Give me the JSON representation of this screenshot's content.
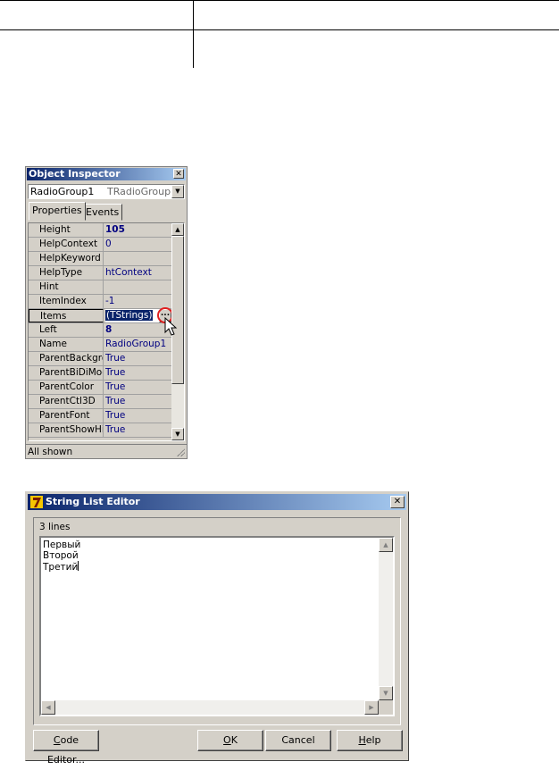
{
  "object_inspector": {
    "title": "Object Inspector",
    "component_name": "RadioGroup1",
    "component_type": "TRadioGroup",
    "tabs": [
      {
        "label": "Properties",
        "active": true
      },
      {
        "label": "Events",
        "active": false
      }
    ],
    "properties": [
      {
        "name": "Height",
        "value": "105",
        "bold": true
      },
      {
        "name": "HelpContext",
        "value": "0"
      },
      {
        "name": "HelpKeyword",
        "value": ""
      },
      {
        "name": "HelpType",
        "value": "htContext"
      },
      {
        "name": "Hint",
        "value": ""
      },
      {
        "name": "ItemIndex",
        "value": "-1"
      },
      {
        "name": "Items",
        "value": "(TStrings)",
        "selected": true
      },
      {
        "name": "Left",
        "value": "8",
        "bold": true
      },
      {
        "name": "Name",
        "value": "RadioGroup1"
      },
      {
        "name": "ParentBackgro",
        "value": "True"
      },
      {
        "name": "ParentBiDiMod",
        "value": "True"
      },
      {
        "name": "ParentColor",
        "value": "True"
      },
      {
        "name": "ParentCtl3D",
        "value": "True"
      },
      {
        "name": "ParentFont",
        "value": "True"
      },
      {
        "name": "ParentShowHir",
        "value": "True"
      }
    ],
    "ellipsis_label": "...",
    "status": "All shown"
  },
  "string_list_editor": {
    "title": "String List Editor",
    "line_count": "3 lines",
    "lines": [
      "Первый",
      "Второй",
      "Третий"
    ],
    "buttons": {
      "code_editor": "Code Editor...",
      "ok": "OK",
      "cancel": "Cancel",
      "help": "Help"
    }
  },
  "colors": {
    "title_bar_start": "#0a246a",
    "title_bar_end": "#a6caf0",
    "window_face": "#d4d0c8",
    "value_text": "#000080",
    "highlight_circle": "#e02020"
  }
}
